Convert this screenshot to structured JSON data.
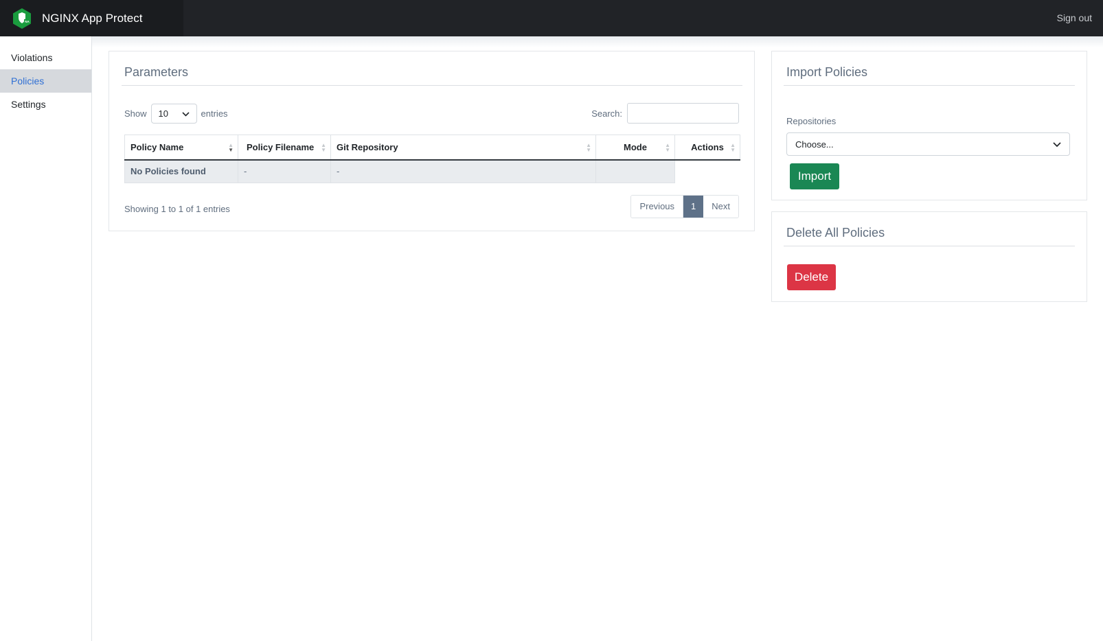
{
  "app": {
    "title": "NGINX App Protect",
    "sign_out": "Sign out",
    "logo_icon": "nginx-shield-icon",
    "brand_color": "#1a9c3e"
  },
  "sidebar": {
    "items": [
      {
        "label": "Violations",
        "active": false
      },
      {
        "label": "Policies",
        "active": true
      },
      {
        "label": "Settings",
        "active": false
      }
    ]
  },
  "parameters": {
    "title": "Parameters",
    "show_label": "Show",
    "entries_value": "10",
    "entries_label": "entries",
    "search_label": "Search:",
    "search_value": "",
    "columns": [
      "Policy Name",
      "Policy Filename",
      "Git Repository",
      "Mode",
      "Actions"
    ],
    "rows": [
      [
        "No Policies found",
        "-",
        "-",
        "",
        ""
      ]
    ],
    "info": "Showing 1 to 1 of 1 entries",
    "pagination": {
      "previous": "Previous",
      "current": "1",
      "next": "Next"
    }
  },
  "import_policies": {
    "title": "Import Policies",
    "repositories_label": "Repositories",
    "repositories_value": "Choose...",
    "import_button": "Import",
    "import_color": "#1a8754"
  },
  "delete_policies": {
    "title": "Delete All Policies",
    "delete_button": "Delete",
    "delete_color": "#dc3545"
  }
}
